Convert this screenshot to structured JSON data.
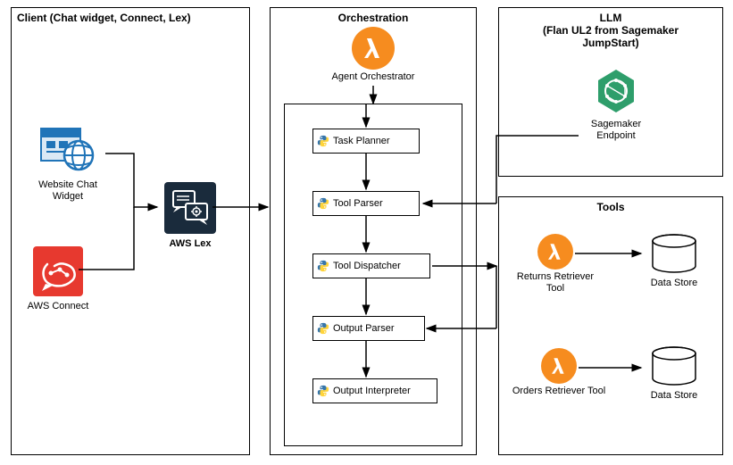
{
  "client": {
    "title": "Client (Chat widget, Connect, Lex)",
    "chat_widget": "Website Chat\nWidget",
    "connect": "AWS Connect",
    "lex": "AWS Lex"
  },
  "orchestration": {
    "title": "Orchestration",
    "orchestrator": "Agent Orchestrator",
    "steps": [
      "Task Planner",
      "Tool Parser",
      "Tool Dispatcher",
      "Output Parser",
      "Output Interpreter"
    ]
  },
  "llm": {
    "title": "LLM\n(Flan UL2 from Sagemaker\nJumpStart)",
    "endpoint": "Sagemaker\nEndpoint"
  },
  "tools": {
    "title": "Tools",
    "returns": "Returns Retriever\nTool",
    "orders": "Orders Retriever Tool",
    "datastore": "Data Store"
  }
}
